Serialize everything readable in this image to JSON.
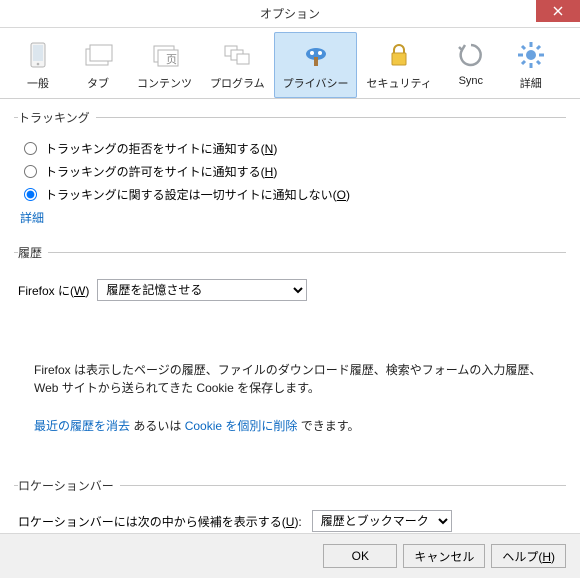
{
  "window": {
    "title": "オプション"
  },
  "tabs": {
    "general": "一般",
    "tab": "タブ",
    "content": "コンテンツ",
    "programs": "プログラム",
    "privacy": "プライバシー",
    "security": "セキュリティ",
    "sync": "Sync",
    "advanced": "詳細"
  },
  "tracking": {
    "legend": "トラッキング",
    "opt_reject_pre": "トラッキングの拒否をサイトに通知する(",
    "opt_reject_key": "N",
    "opt_allow_pre": "トラッキングの許可をサイトに通知する(",
    "opt_allow_key": "H",
    "opt_none_pre": "トラッキングに関する設定は一切サイトに通知しない(",
    "opt_none_key": "O",
    "paren_close": ")",
    "details": "詳細"
  },
  "history": {
    "legend": "履歴",
    "label_pre": "Firefox に(",
    "label_key": "W",
    "select_value": "履歴を記憶させる",
    "desc": "Firefox は表示したページの履歴、ファイルのダウンロード履歴、検索やフォームの入力履歴、Web サイトから送られてきた Cookie を保存します。",
    "link_clear": "最近の履歴を消去",
    "mid1": " あるいは ",
    "link_cookie": "Cookie を個別に削除",
    "mid2": " できます。"
  },
  "locbar": {
    "legend": "ロケーションバー",
    "label_pre": "ロケーションバーには次の中から候補を表示する(",
    "label_key": "U",
    "label_post": "):",
    "select_value": "履歴とブックマーク"
  },
  "footer": {
    "ok": "OK",
    "cancel": "キャンセル",
    "help_pre": "ヘルプ(",
    "help_key": "H",
    "help_post": ")"
  }
}
